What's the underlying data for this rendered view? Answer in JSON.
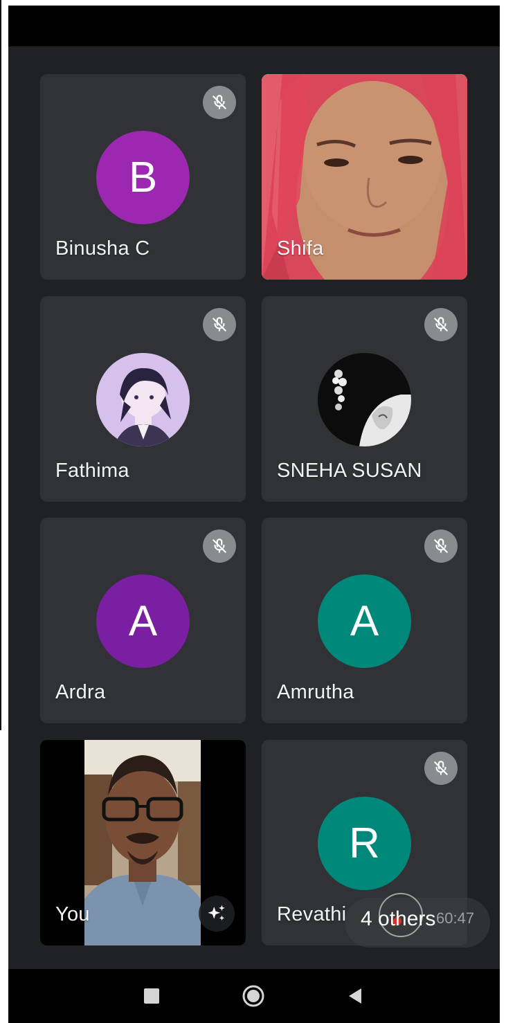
{
  "participants": [
    {
      "name": "Binusha C",
      "initial": "B",
      "avatar_color": "#9c27b0",
      "muted": true,
      "type": "initial"
    },
    {
      "name": "Shifa",
      "type": "video",
      "muted": false
    },
    {
      "name": "Fathima",
      "type": "photo",
      "muted": true
    },
    {
      "name": "SNEHA SUSAN",
      "type": "photo",
      "muted": true
    },
    {
      "name": "Ardra",
      "initial": "A",
      "avatar_color": "#7b1fa2",
      "muted": true,
      "type": "initial"
    },
    {
      "name": "Amrutha",
      "initial": "A",
      "avatar_color": "#00897b",
      "muted": true,
      "type": "initial"
    },
    {
      "name": "You",
      "type": "video",
      "muted": false
    },
    {
      "name": "Revathi",
      "initial": "R",
      "avatar_color": "#00897b",
      "muted": true,
      "type": "initial"
    }
  ],
  "overlay": {
    "others_label": "4 others",
    "timer": "60:47"
  },
  "icons": {
    "mute": "mic-off-icon",
    "effects": "sparkle-effects-icon",
    "nav": [
      "square-recents-icon",
      "circle-home-icon",
      "triangle-back-icon"
    ]
  },
  "colors": {
    "background": "#202124",
    "tile": "#3c4043",
    "mute_badge": "#8a8b8e"
  }
}
